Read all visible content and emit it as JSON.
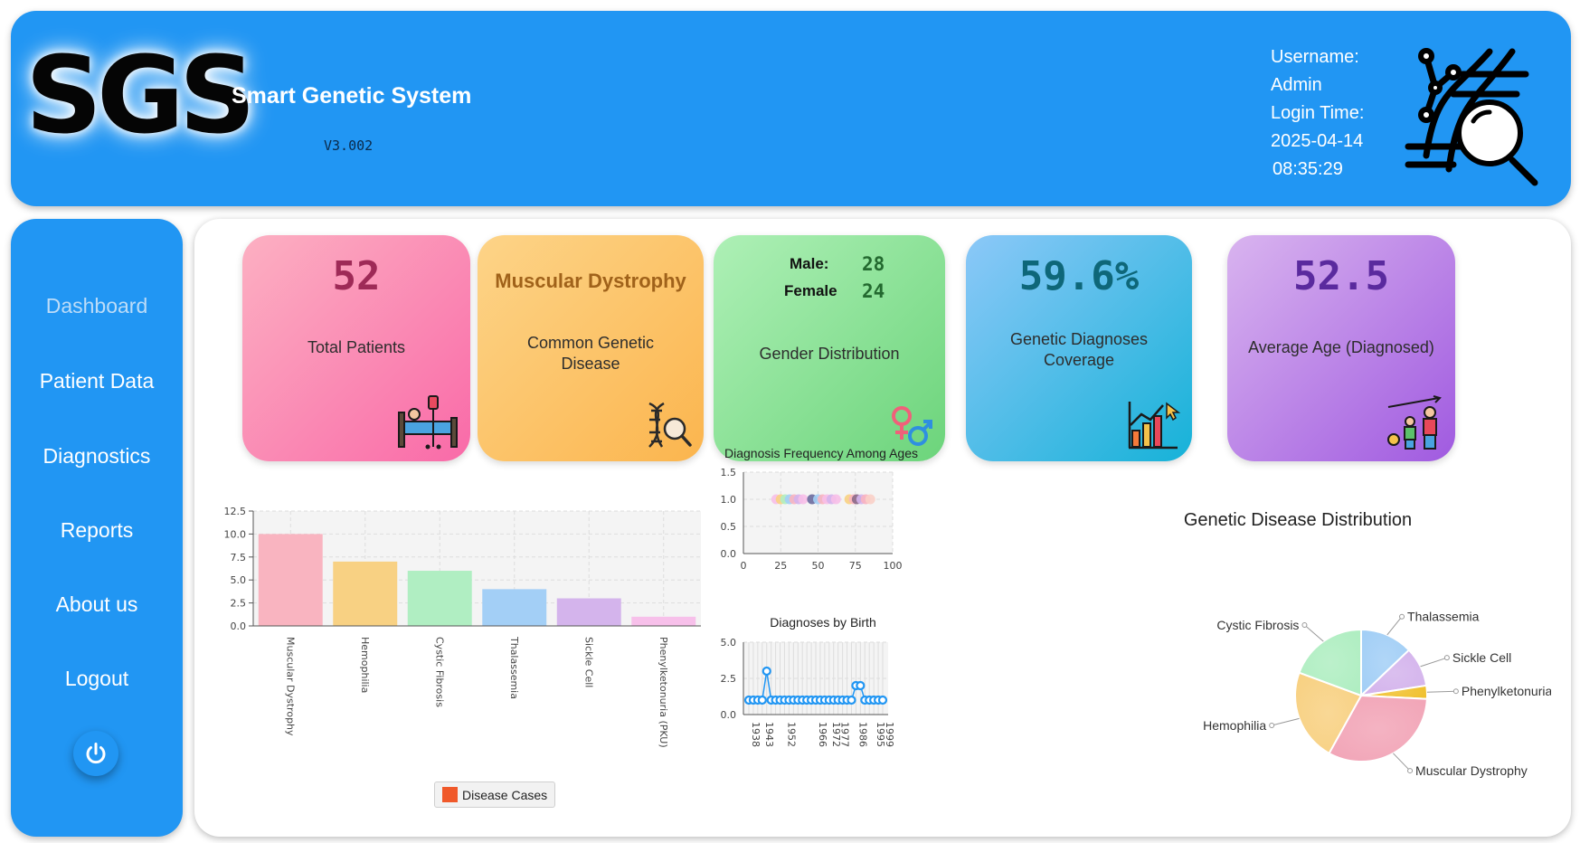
{
  "header": {
    "logo": "SGS",
    "app_title": "Smart Genetic System",
    "version": "V3.002",
    "username_label": "Username:",
    "username": "Admin",
    "login_time_label": "Login Time:",
    "login_date": "2025-04-14",
    "login_time": "08:35:29",
    "icon": "dna-search-icon"
  },
  "sidebar": {
    "items": [
      {
        "label": "Dashboard",
        "active": true
      },
      {
        "label": "Patient Data",
        "active": false
      },
      {
        "label": "Diagnostics",
        "active": false
      },
      {
        "label": "Reports",
        "active": false
      },
      {
        "label": "About us",
        "active": false
      },
      {
        "label": "Logout",
        "active": false
      }
    ],
    "power_icon": "power-icon"
  },
  "cards": {
    "total_patients": {
      "value": "52",
      "label": "Total Patients",
      "icon": "patient-bed-icon",
      "value_color": "#9e2a57"
    },
    "common_disease": {
      "value": "Muscular Dystrophy",
      "label": "Common Genetic Disease",
      "icon": "dna-magnifier-icon",
      "value_color": "#a0621a"
    },
    "gender": {
      "male_label": "Male:",
      "male_value": "28",
      "female_label": "Female",
      "female_value": "24",
      "label": "Gender Distribution",
      "icon": "gender-icon",
      "value_color": "#23692f"
    },
    "coverage": {
      "value": "59.6%",
      "label": "Genetic Diagnoses Coverage",
      "icon": "growth-chart-icon",
      "value_color": "#0e6779"
    },
    "average_age": {
      "value": "52.5",
      "label": "Average Age (Diagnosed)",
      "icon": "age-growth-icon",
      "value_color": "#5a2a9e"
    }
  },
  "chart_data": [
    {
      "type": "bar",
      "title": "",
      "categories": [
        "Muscular Dystrophy",
        "Hemophilia",
        "Cystic Fibrosis",
        "Thalassemia",
        "Sickle Cell",
        "Phenylketonuria (PKU)"
      ],
      "values": [
        10,
        7,
        6,
        4,
        3,
        1
      ],
      "colors": [
        "#f9b4c0",
        "#f8d183",
        "#b0eec2",
        "#a3cff6",
        "#d4b4ec",
        "#f7c0ea"
      ],
      "ylim": [
        0,
        12.5
      ],
      "yticks": [
        "0.0",
        "2.5",
        "5.0",
        "7.5",
        "10.0",
        "12.5"
      ],
      "legend": [
        {
          "name": "Disease Cases",
          "color": "#f0592a"
        }
      ],
      "legend_position": "bottom",
      "grid": true
    },
    {
      "type": "scatter",
      "title": "Diagnosis Frequency Among Ages",
      "xlim": [
        0,
        100
      ],
      "ylim": [
        0,
        1.5
      ],
      "xticks": [
        "0",
        "25",
        "50",
        "75",
        "100"
      ],
      "yticks": [
        "0.0",
        "0.5",
        "1.0",
        "1.5"
      ],
      "points": [
        {
          "x": 22,
          "y": 1,
          "color": "#f7bfe8"
        },
        {
          "x": 25,
          "y": 1,
          "color": "#f8d183"
        },
        {
          "x": 28,
          "y": 1,
          "color": "#b0eec2"
        },
        {
          "x": 31,
          "y": 1,
          "color": "#a3cff6"
        },
        {
          "x": 34,
          "y": 1,
          "color": "#f9b4c0"
        },
        {
          "x": 37,
          "y": 1,
          "color": "#d4b4ec"
        },
        {
          "x": 40,
          "y": 1,
          "color": "#f7bfe8"
        },
        {
          "x": 46,
          "y": 1,
          "color": "#6b6b9e"
        },
        {
          "x": 50,
          "y": 1,
          "color": "#a3cff6"
        },
        {
          "x": 53,
          "y": 1,
          "color": "#f9b4c0"
        },
        {
          "x": 56,
          "y": 1,
          "color": "#f7bfe8"
        },
        {
          "x": 59,
          "y": 1,
          "color": "#d4b4ec"
        },
        {
          "x": 62,
          "y": 1,
          "color": "#f7bfe8"
        },
        {
          "x": 71,
          "y": 1,
          "color": "#f8d183"
        },
        {
          "x": 74,
          "y": 1,
          "color": "#f9b4c0"
        },
        {
          "x": 76,
          "y": 1,
          "color": "#8a6a8a"
        },
        {
          "x": 79,
          "y": 1,
          "color": "#d4b4ec"
        },
        {
          "x": 82,
          "y": 1,
          "color": "#f9b4c0"
        },
        {
          "x": 85,
          "y": 1,
          "color": "#f9d0c8"
        }
      ],
      "grid": true
    },
    {
      "type": "line",
      "title": "Diagnoses by Birth",
      "x": [
        "1938",
        "1940",
        "1941",
        "1943",
        "1944",
        "1946",
        "1948",
        "1950",
        "1952",
        "1954",
        "1956",
        "1958",
        "1960",
        "1962",
        "1964",
        "1966",
        "1968",
        "1970",
        "1972",
        "1974",
        "1977",
        "1979",
        "1981",
        "1983",
        "1986",
        "1988",
        "1990",
        "1993",
        "1995",
        "1997",
        "1999"
      ],
      "values": [
        1,
        1,
        1,
        1,
        3,
        1,
        1,
        1,
        1,
        1,
        1,
        1,
        1,
        1,
        1,
        1,
        1,
        1,
        1,
        1,
        1,
        1,
        1,
        1,
        2,
        2,
        1,
        1,
        1,
        1,
        1
      ],
      "xticks": [
        "1938",
        "1943",
        "1952",
        "1966",
        "1972",
        "1977",
        "1986",
        "1995",
        "1999"
      ],
      "ylim": [
        0,
        5
      ],
      "yticks": [
        "0.0",
        "2.5",
        "5.0"
      ],
      "color": "#2196f3",
      "grid": true
    },
    {
      "type": "pie",
      "title": "Genetic Disease Distribution",
      "slices": [
        {
          "label": "Thalassemia",
          "value": 4,
          "color": "#a3cff6"
        },
        {
          "label": "Sickle Cell",
          "value": 3,
          "color": "#d4b4ec"
        },
        {
          "label": "Phenylketonuria (PKU)",
          "value": 1,
          "color": "#f0c02c"
        },
        {
          "label": "Muscular Dystrophy",
          "value": 10,
          "color": "#f2a6b8"
        },
        {
          "label": "Hemophilia",
          "value": 7,
          "color": "#f8d183"
        },
        {
          "label": "Cystic Fibrosis",
          "value": 6,
          "color": "#b0eec2"
        }
      ]
    }
  ]
}
